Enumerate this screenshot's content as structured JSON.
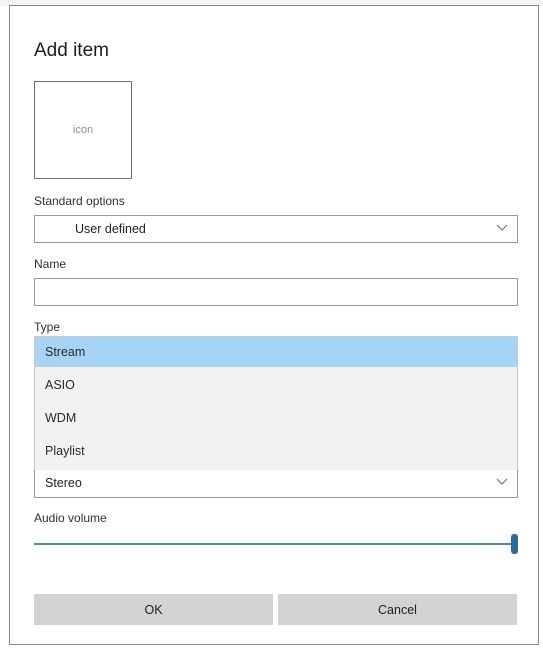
{
  "dialog": {
    "title": "Add item",
    "icon_placeholder": "icon",
    "standard_options": {
      "label": "Standard options",
      "value": "User defined"
    },
    "name": {
      "label": "Name",
      "value": ""
    },
    "type": {
      "label": "Type",
      "options": [
        "Stream",
        "ASIO",
        "WDM",
        "Playlist"
      ],
      "highlighted": "Stream"
    },
    "channel_select": {
      "value": "Stereo"
    },
    "audio_volume": {
      "label": "Audio volume",
      "level_percent": 100
    },
    "buttons": {
      "ok": "OK",
      "cancel": "Cancel"
    }
  },
  "colors": {
    "highlight": "#a6d4f7",
    "slider_track": "#4e87b5",
    "slider_thumb": "#2d6a9b",
    "button_bg": "#d3d3d3"
  }
}
